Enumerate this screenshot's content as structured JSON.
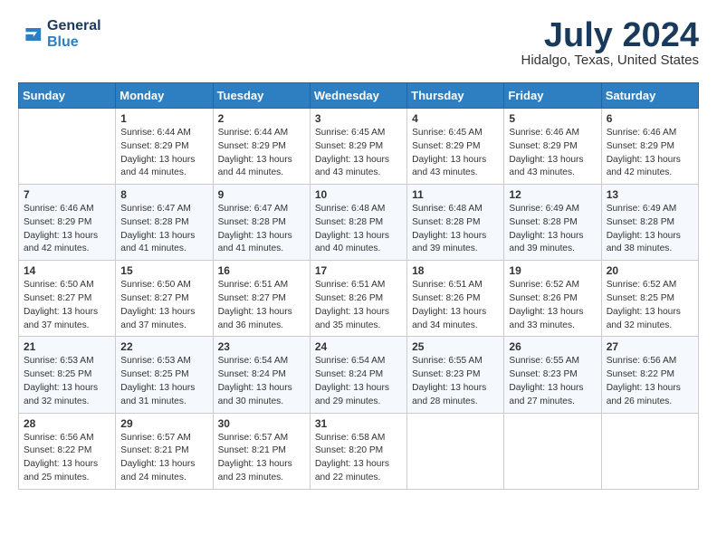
{
  "logo": {
    "line1": "General",
    "line2": "Blue"
  },
  "title": {
    "month_year": "July 2024",
    "location": "Hidalgo, Texas, United States"
  },
  "weekdays": [
    "Sunday",
    "Monday",
    "Tuesday",
    "Wednesday",
    "Thursday",
    "Friday",
    "Saturday"
  ],
  "weeks": [
    [
      {
        "day": null
      },
      {
        "day": 1,
        "sunrise": "6:44 AM",
        "sunset": "8:29 PM",
        "daylight": "13 hours and 44 minutes."
      },
      {
        "day": 2,
        "sunrise": "6:44 AM",
        "sunset": "8:29 PM",
        "daylight": "13 hours and 44 minutes."
      },
      {
        "day": 3,
        "sunrise": "6:45 AM",
        "sunset": "8:29 PM",
        "daylight": "13 hours and 43 minutes."
      },
      {
        "day": 4,
        "sunrise": "6:45 AM",
        "sunset": "8:29 PM",
        "daylight": "13 hours and 43 minutes."
      },
      {
        "day": 5,
        "sunrise": "6:46 AM",
        "sunset": "8:29 PM",
        "daylight": "13 hours and 43 minutes."
      },
      {
        "day": 6,
        "sunrise": "6:46 AM",
        "sunset": "8:29 PM",
        "daylight": "13 hours and 42 minutes."
      }
    ],
    [
      {
        "day": 7,
        "sunrise": "6:46 AM",
        "sunset": "8:29 PM",
        "daylight": "13 hours and 42 minutes."
      },
      {
        "day": 8,
        "sunrise": "6:47 AM",
        "sunset": "8:28 PM",
        "daylight": "13 hours and 41 minutes."
      },
      {
        "day": 9,
        "sunrise": "6:47 AM",
        "sunset": "8:28 PM",
        "daylight": "13 hours and 41 minutes."
      },
      {
        "day": 10,
        "sunrise": "6:48 AM",
        "sunset": "8:28 PM",
        "daylight": "13 hours and 40 minutes."
      },
      {
        "day": 11,
        "sunrise": "6:48 AM",
        "sunset": "8:28 PM",
        "daylight": "13 hours and 39 minutes."
      },
      {
        "day": 12,
        "sunrise": "6:49 AM",
        "sunset": "8:28 PM",
        "daylight": "13 hours and 39 minutes."
      },
      {
        "day": 13,
        "sunrise": "6:49 AM",
        "sunset": "8:28 PM",
        "daylight": "13 hours and 38 minutes."
      }
    ],
    [
      {
        "day": 14,
        "sunrise": "6:50 AM",
        "sunset": "8:27 PM",
        "daylight": "13 hours and 37 minutes."
      },
      {
        "day": 15,
        "sunrise": "6:50 AM",
        "sunset": "8:27 PM",
        "daylight": "13 hours and 37 minutes."
      },
      {
        "day": 16,
        "sunrise": "6:51 AM",
        "sunset": "8:27 PM",
        "daylight": "13 hours and 36 minutes."
      },
      {
        "day": 17,
        "sunrise": "6:51 AM",
        "sunset": "8:26 PM",
        "daylight": "13 hours and 35 minutes."
      },
      {
        "day": 18,
        "sunrise": "6:51 AM",
        "sunset": "8:26 PM",
        "daylight": "13 hours and 34 minutes."
      },
      {
        "day": 19,
        "sunrise": "6:52 AM",
        "sunset": "8:26 PM",
        "daylight": "13 hours and 33 minutes."
      },
      {
        "day": 20,
        "sunrise": "6:52 AM",
        "sunset": "8:25 PM",
        "daylight": "13 hours and 32 minutes."
      }
    ],
    [
      {
        "day": 21,
        "sunrise": "6:53 AM",
        "sunset": "8:25 PM",
        "daylight": "13 hours and 32 minutes."
      },
      {
        "day": 22,
        "sunrise": "6:53 AM",
        "sunset": "8:25 PM",
        "daylight": "13 hours and 31 minutes."
      },
      {
        "day": 23,
        "sunrise": "6:54 AM",
        "sunset": "8:24 PM",
        "daylight": "13 hours and 30 minutes."
      },
      {
        "day": 24,
        "sunrise": "6:54 AM",
        "sunset": "8:24 PM",
        "daylight": "13 hours and 29 minutes."
      },
      {
        "day": 25,
        "sunrise": "6:55 AM",
        "sunset": "8:23 PM",
        "daylight": "13 hours and 28 minutes."
      },
      {
        "day": 26,
        "sunrise": "6:55 AM",
        "sunset": "8:23 PM",
        "daylight": "13 hours and 27 minutes."
      },
      {
        "day": 27,
        "sunrise": "6:56 AM",
        "sunset": "8:22 PM",
        "daylight": "13 hours and 26 minutes."
      }
    ],
    [
      {
        "day": 28,
        "sunrise": "6:56 AM",
        "sunset": "8:22 PM",
        "daylight": "13 hours and 25 minutes."
      },
      {
        "day": 29,
        "sunrise": "6:57 AM",
        "sunset": "8:21 PM",
        "daylight": "13 hours and 24 minutes."
      },
      {
        "day": 30,
        "sunrise": "6:57 AM",
        "sunset": "8:21 PM",
        "daylight": "13 hours and 23 minutes."
      },
      {
        "day": 31,
        "sunrise": "6:58 AM",
        "sunset": "8:20 PM",
        "daylight": "13 hours and 22 minutes."
      },
      {
        "day": null
      },
      {
        "day": null
      },
      {
        "day": null
      }
    ]
  ],
  "labels": {
    "sunrise": "Sunrise:",
    "sunset": "Sunset:",
    "daylight": "Daylight:"
  }
}
